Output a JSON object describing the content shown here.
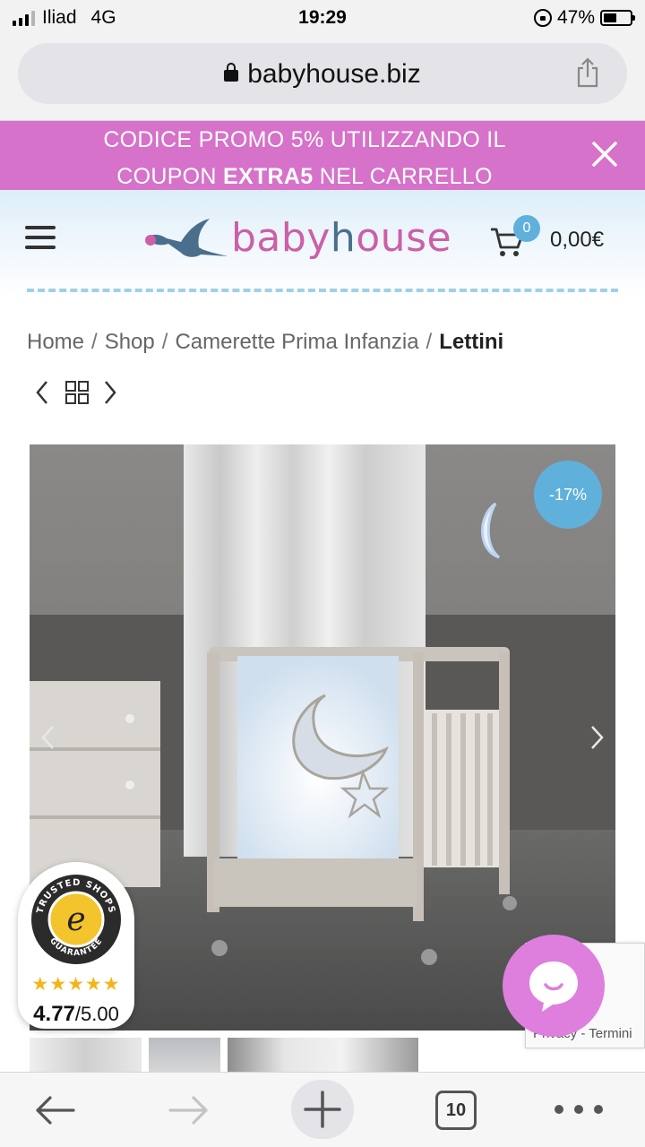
{
  "status_bar": {
    "carrier": "Iliad",
    "network": "4G",
    "time": "19:29",
    "battery": "47%"
  },
  "browser": {
    "url": "babyhouse.biz",
    "tab_count": "10"
  },
  "promo": {
    "line1": "CODICE PROMO 5%  UTILIZZANDO IL",
    "line2_pre": "COUPON ",
    "line2_code": "EXTRA5",
    "line2_post": " NEL CARRELLO"
  },
  "header": {
    "logo_text_pink_1": "baby",
    "logo_text_blue": "h",
    "logo_text_pink_2": "ouse",
    "cart_count": "0",
    "cart_total": "0,00€"
  },
  "breadcrumb": {
    "items": [
      "Home",
      "Shop",
      "Camerette Prima Infanzia"
    ],
    "current": "Lettini",
    "separator": "/"
  },
  "product": {
    "sale_badge": "-17%"
  },
  "trusted_shops": {
    "seal_top": "TRUSTED SHOPS",
    "seal_bottom": "GUARANTEE",
    "stars": "★★★★★",
    "rating": "4.77",
    "rating_max": "/5.00"
  },
  "recaptcha": {
    "text": "Privacy - Termini"
  },
  "colors": {
    "promo_bg": "#d672c9",
    "accent_blue": "#5fb1dc",
    "chat_pink": "#de7fde",
    "logo_pink": "#cc5fa7",
    "logo_blue": "#4a6f8d"
  }
}
